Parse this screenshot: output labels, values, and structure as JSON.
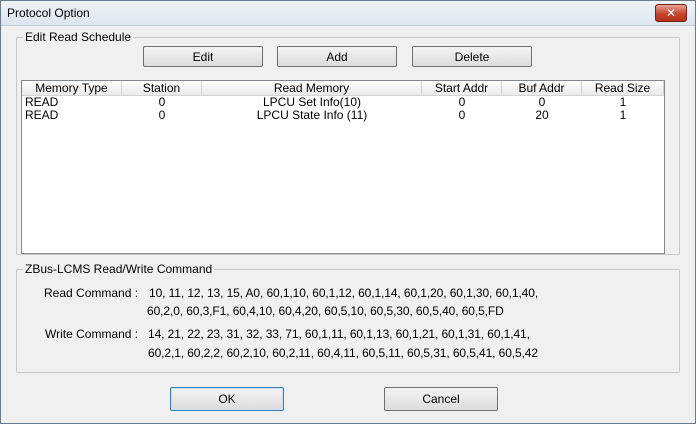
{
  "window": {
    "title": "Protocol Option",
    "close_glyph": "✕"
  },
  "schedule": {
    "group_title": "Edit Read Schedule",
    "buttons": {
      "edit": "Edit",
      "add": "Add",
      "delete": "Delete"
    },
    "columns": [
      "Memory Type",
      "Station",
      "Read Memory",
      "Start Addr",
      "Buf Addr",
      "Read Size"
    ],
    "rows": [
      [
        "READ",
        "0",
        "LPCU Set Info(10)",
        "0",
        "0",
        "1"
      ],
      [
        "READ",
        "0",
        "LPCU State Info (11)",
        "0",
        "20",
        "1"
      ]
    ]
  },
  "commands": {
    "group_title": "ZBus-LCMS Read/Write Command",
    "read_label": "Read Command :",
    "read_line1": "10,   11,   12,   13,   15,   A0,   60,1,10,   60,1,12,   60,1,14,   60,1,20,   60,1,30,   60,1,40,",
    "read_line2": "60,2,0,   60,3,F1,   60,4,10,   60,4,20,   60,5,10,   60,5,30,   60,5,40,   60,5,FD",
    "write_label": "Write Command :",
    "write_line1": "14,   21,   22,   23,   31,   32,   33,   71,   60,1,11,   60,1,13,   60,1,21,   60,1,31,   60,1,41,",
    "write_line2": "60,2,1,   60,2,2,   60,2,10,   60,2,11,   60,4,11,   60,5,11,   60,5,31,   60,5,41,   60,5,42"
  },
  "footer": {
    "ok": "OK",
    "cancel": "Cancel"
  }
}
